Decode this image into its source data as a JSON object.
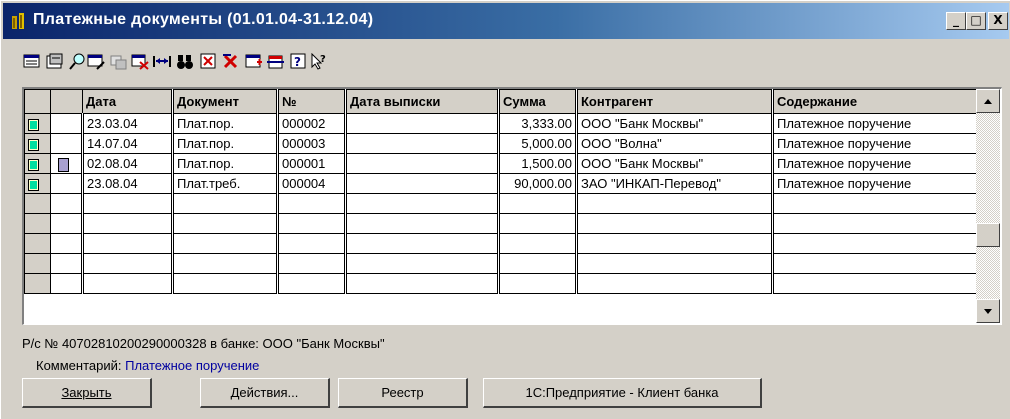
{
  "window": {
    "title": "Платежные документы (01.01.04-31.12.04)",
    "minimize": "_",
    "maximize": "□",
    "close": "X"
  },
  "toolbar": {
    "icons": [
      "new-doc-icon",
      "copy-doc-icon",
      "find-icon",
      "edit-icon",
      "cut-icon",
      "delete-icon",
      "column-width-icon",
      "binoculars-icon",
      "filter-icon",
      "clear-filter-icon",
      "journal-icon",
      "period-icon",
      "help-icon",
      "context-help-icon"
    ]
  },
  "table": {
    "headers": [
      "Дата",
      "Документ",
      "№",
      "Дата выписки",
      "Сумма",
      "Контрагент",
      "Содержание"
    ],
    "rows": [
      {
        "date": "23.03.04",
        "doc": "Плат.пор.",
        "num": "000002",
        "issue_date": "",
        "sum": "3,333.00",
        "counterparty": "ООО \"Банк Москвы\"",
        "content": "Платежное поручение"
      },
      {
        "date": "14.07.04",
        "doc": "Плат.пор.",
        "num": "000003",
        "issue_date": "",
        "sum": "5,000.00",
        "counterparty": "ООО \"Волна\"",
        "content": "Платежное поручение"
      },
      {
        "date": "02.08.04",
        "doc": "Плат.пор.",
        "num": "000001",
        "issue_date": "",
        "sum": "1,500.00",
        "counterparty": "ООО \"Банк Москвы\"",
        "content": "Платежное поручение"
      },
      {
        "date": "23.08.04",
        "doc": "Плат.треб.",
        "num": "000004",
        "issue_date": "",
        "sum": "90,000.00",
        "counterparty": "ЗАО \"ИНКАП-Перевод\"",
        "content": "Платежное поручение"
      }
    ],
    "empty_rows": 5,
    "selected_row": 2
  },
  "status": {
    "account": "Р/с № 40702810200290000328 в банке: ООО \"Банк Москвы\"",
    "comment_label": "Комментарий:",
    "comment_value": "Платежное поручение"
  },
  "buttons": {
    "close": "Закрыть",
    "actions": "Действия...",
    "registry": "Реестр",
    "client_bank": "1С:Предприятие - Клиент банка"
  },
  "colors": {
    "title_start": "#0a246a",
    "title_end": "#a6caf0",
    "face": "#d4d0c8",
    "comment_text": "#0000a0"
  }
}
